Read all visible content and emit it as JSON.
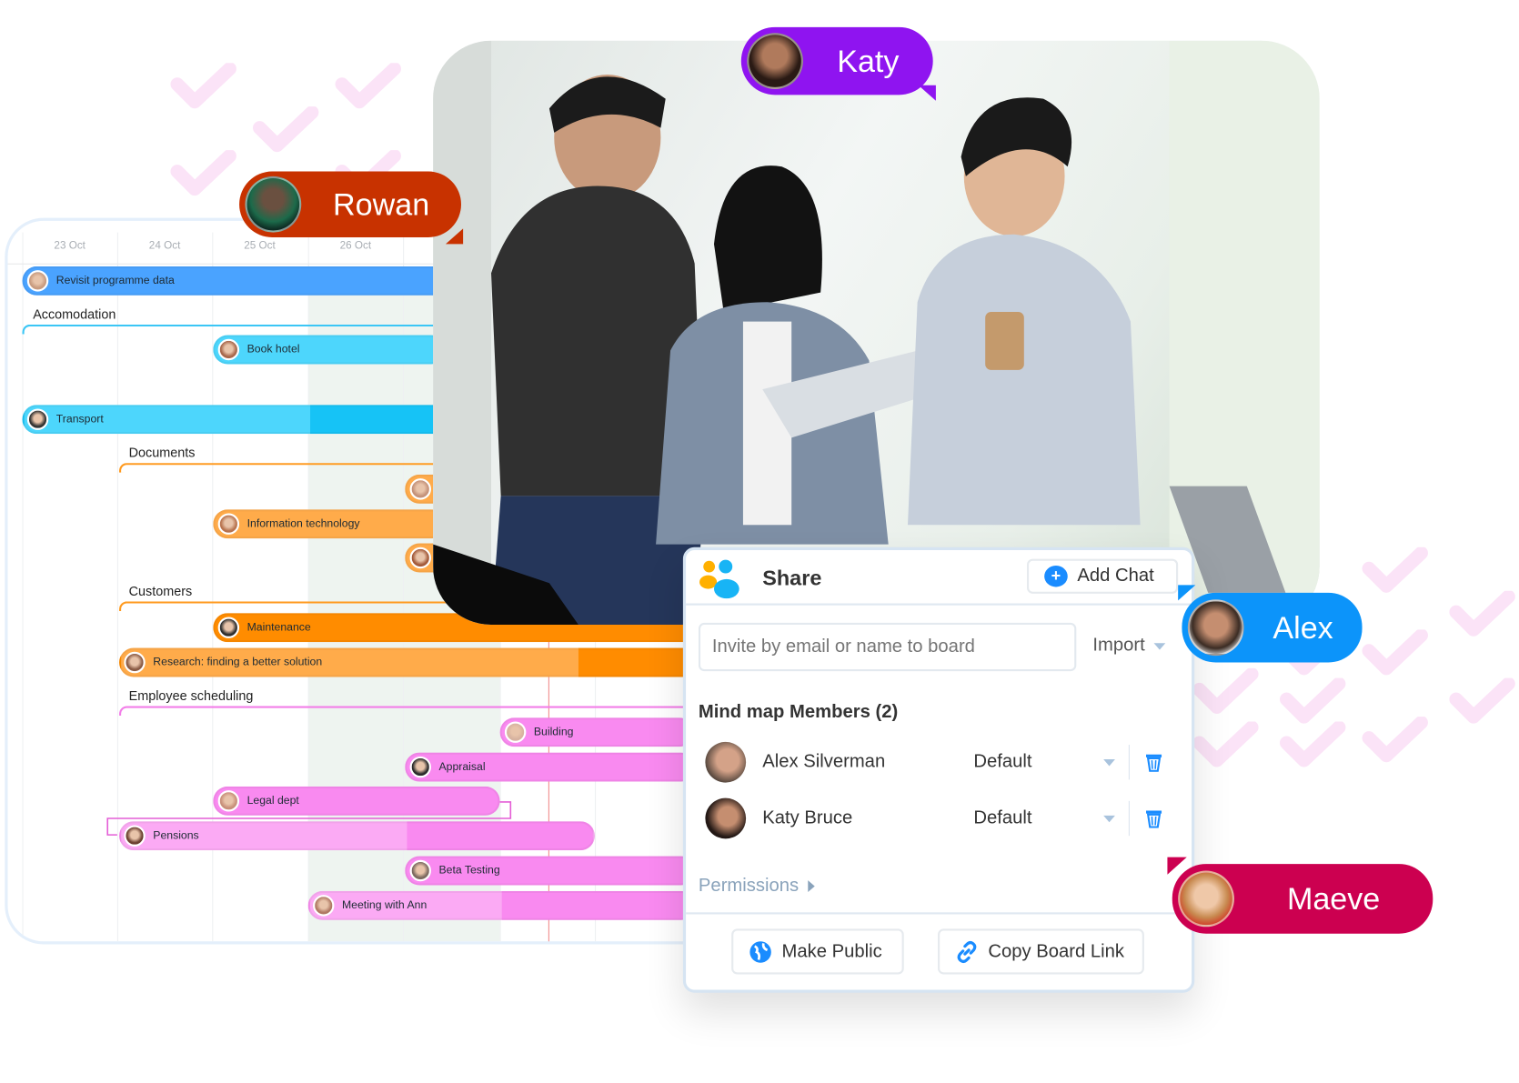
{
  "gantt": {
    "dates": [
      "23 Oct",
      "24 Oct",
      "25 Oct",
      "26 Oct"
    ],
    "groups": [
      {
        "label": "Accomodation",
        "color": "#3bc6f5"
      },
      {
        "label": "Documents",
        "color": "#ff9a1f"
      },
      {
        "label": "Customers",
        "color": "#ff9a1f"
      },
      {
        "label": "Employee scheduling",
        "color": "#f27ee8"
      }
    ],
    "tasks": [
      {
        "label": "Revisit programme data",
        "color": "#4aa3ff"
      },
      {
        "label": "Book hotel",
        "color": "#4dd6fc"
      },
      {
        "label": "Transport",
        "color": "#4dd6fc"
      },
      {
        "label": "",
        "color": "#ffab4a"
      },
      {
        "label": "Information technology",
        "color": "#ffab4a"
      },
      {
        "label": "",
        "color": "#ffab4a"
      },
      {
        "label": "Maintenance",
        "color": "#ff8c00"
      },
      {
        "label": "Research: finding a better solution",
        "color": "#ffab4a"
      },
      {
        "label": "Building",
        "color": "#f98af0"
      },
      {
        "label": "Appraisal",
        "color": "#f98af0"
      },
      {
        "label": "Legal dept",
        "color": "#f98af0"
      },
      {
        "label": "Pensions",
        "color": "#fbaaf4"
      },
      {
        "label": "Beta Testing",
        "color": "#f98af0"
      },
      {
        "label": "Meeting with Ann",
        "color": "#fbaaf4"
      }
    ]
  },
  "collaborators": {
    "katy": {
      "name": "Katy",
      "color": "#8f14f0"
    },
    "rowan": {
      "name": "Rowan",
      "color": "#c83200"
    },
    "alex": {
      "name": "Alex",
      "color": "#0c94fa"
    },
    "maeve": {
      "name": "Maeve",
      "color": "#cc0050"
    }
  },
  "share": {
    "title": "Share",
    "add_chat": "Add Chat",
    "invite_placeholder": "Invite by email or name to board",
    "import": "Import",
    "members_heading": "Mind map Members (2)",
    "members": [
      {
        "name": "Alex Silverman",
        "role": "Default"
      },
      {
        "name": "Katy Bruce",
        "role": "Default"
      }
    ],
    "permissions": "Permissions",
    "make_public": "Make Public",
    "copy_link": "Copy Board Link",
    "accent": "#1a8cff"
  }
}
